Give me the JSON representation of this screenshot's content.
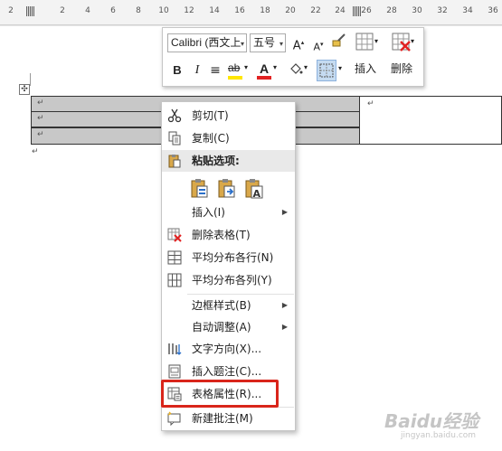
{
  "ruler": {
    "ticks": [
      "2",
      "2",
      "4",
      "6",
      "8",
      "10",
      "12",
      "14",
      "16",
      "18",
      "20",
      "22",
      "24",
      "26",
      "28",
      "30",
      "32",
      "34",
      "36"
    ]
  },
  "mini_toolbar": {
    "font_name": "Calibri (西文上",
    "font_size": "五号",
    "bold": "B",
    "italic": "I",
    "align": "≡",
    "highlight": "ab",
    "font_color": "A",
    "insert_label": "插入",
    "delete_label": "删除",
    "accent_yellow": "#ffe600",
    "accent_red": "#e22222"
  },
  "context_menu": {
    "cut": "剪切(T)",
    "copy": "复制(C)",
    "paste_options": "粘贴选项:",
    "insert": "插入(I)",
    "delete_table": "删除表格(T)",
    "distribute_rows": "平均分布各行(N)",
    "distribute_cols": "平均分布各列(Y)",
    "border_styles": "边框样式(B)",
    "autofit": "自动调整(A)",
    "text_direction": "文字方向(X)...",
    "insert_caption": "插入题注(C)...",
    "table_properties": "表格属性(R)...",
    "new_comment": "新建批注(M)"
  },
  "paragraph_mark": "↵",
  "highlight_color": "#d9251b",
  "watermark": {
    "text": "Baidu经验",
    "sub": "jingyan.baidu.com"
  }
}
